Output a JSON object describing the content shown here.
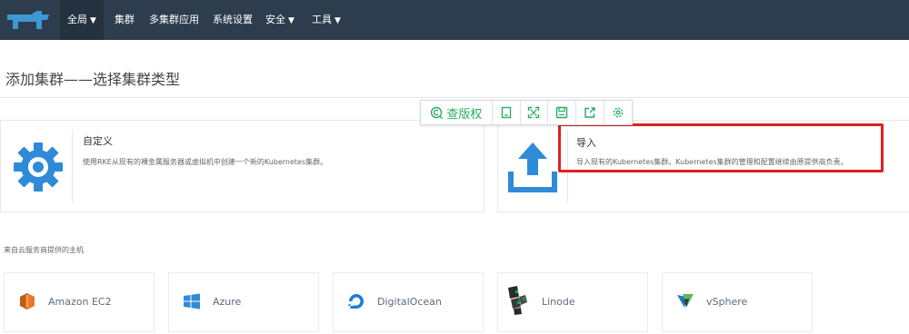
{
  "nav": {
    "items": [
      {
        "label": "全局",
        "dropdown": true
      },
      {
        "label": "集群",
        "dropdown": false
      },
      {
        "label": "多集群应用",
        "dropdown": false
      },
      {
        "label": "系统设置",
        "dropdown": false
      },
      {
        "label": "安全",
        "dropdown": true
      },
      {
        "label": "工具",
        "dropdown": true
      }
    ],
    "chevron": "▼"
  },
  "page": {
    "title": "添加集群——选择集群类型"
  },
  "toolbar": {
    "copyright_label": "查版权",
    "icons": [
      "copyright-search-icon",
      "page-icon",
      "fullscreen-icon",
      "save-icon",
      "share-icon",
      "settings-icon"
    ]
  },
  "cards": {
    "custom": {
      "title": "自定义",
      "description": "使用RKE从现有的裸金属服务器或虚拟机中创建一个新的Kubernetes集群。",
      "icon": "gear-icon"
    },
    "import": {
      "title": "导入",
      "description": "导入现有的Kubernetes集群。Kubernetes集群的管理和配置继续由原提供商负责。",
      "icon": "upload-icon"
    }
  },
  "providers_section": {
    "label": "来自云服务商提供的主机",
    "items": [
      {
        "name": "Amazon EC2",
        "icon": "amazon-ec2-icon"
      },
      {
        "name": "Azure",
        "icon": "azure-icon"
      },
      {
        "name": "DigitalOcean",
        "icon": "digitalocean-icon"
      },
      {
        "name": "Linode",
        "icon": "linode-icon"
      },
      {
        "name": "vSphere",
        "icon": "vsphere-icon"
      }
    ]
  },
  "colors": {
    "nav_bg": "#2d3d4d",
    "accent_blue": "#2f8ad8",
    "highlight_red": "#e02020",
    "toolbar_green": "#27ae60"
  }
}
